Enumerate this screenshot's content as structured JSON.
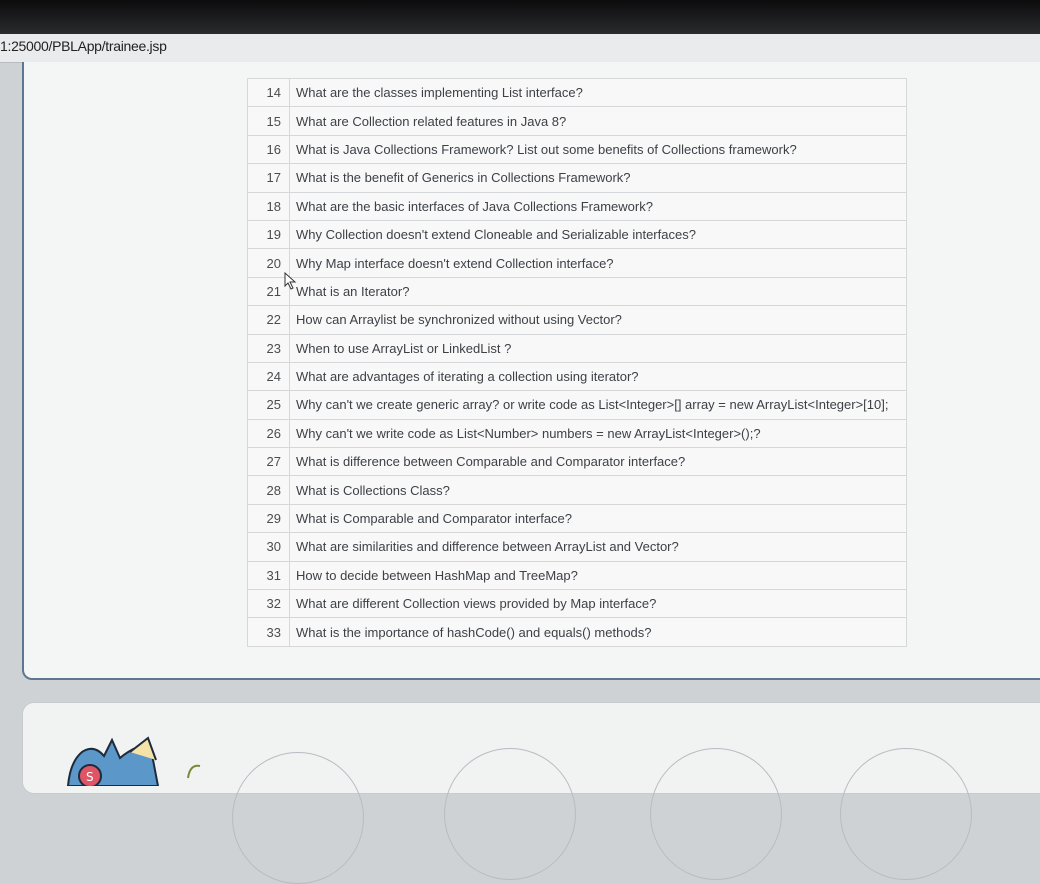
{
  "address_bar": {
    "url": "1:25000/PBLApp/trainee.jsp"
  },
  "questions": [
    {
      "num": "14",
      "text": "What are the classes implementing List interface?"
    },
    {
      "num": "15",
      "text": "What are Collection related features in Java 8?"
    },
    {
      "num": "16",
      "text": "What is Java Collections Framework? List out some benefits of Collections framework?"
    },
    {
      "num": "17",
      "text": "What is the benefit of Generics in Collections Framework?"
    },
    {
      "num": "18",
      "text": "What are the basic interfaces of Java Collections Framework?"
    },
    {
      "num": "19",
      "text": "Why Collection doesn't extend Cloneable and Serializable interfaces?"
    },
    {
      "num": "20",
      "text": "Why Map interface doesn't extend Collection interface?"
    },
    {
      "num": "21",
      "text": "What is an Iterator?"
    },
    {
      "num": "22",
      "text": "How can Arraylist be synchronized without using Vector?"
    },
    {
      "num": "23",
      "text": "When to use ArrayList or LinkedList ?"
    },
    {
      "num": "24",
      "text": "What are advantages of iterating a collection using iterator?"
    },
    {
      "num": "25",
      "text": "Why can't we create generic array? or write code as List<Integer>[] array = new ArrayList<Integer>[10];"
    },
    {
      "num": "26",
      "text": "Why can't we write code as List<Number> numbers = new ArrayList<Integer>();?"
    },
    {
      "num": "27",
      "text": "What is difference between Comparable and Comparator interface?"
    },
    {
      "num": "28",
      "text": "What is Collections Class?"
    },
    {
      "num": "29",
      "text": "What is Comparable and Comparator interface?"
    },
    {
      "num": "30",
      "text": "What are similarities and difference between ArrayList and Vector?"
    },
    {
      "num": "31",
      "text": "How to decide between HashMap and TreeMap?"
    },
    {
      "num": "32",
      "text": "What are different Collection views provided by Map interface?"
    },
    {
      "num": "33",
      "text": "What is the importance of hashCode() and equals() methods?"
    }
  ],
  "icons": {
    "cursor": "mouse-pointer-icon",
    "sticker": "cartoon-sticker-icon"
  }
}
